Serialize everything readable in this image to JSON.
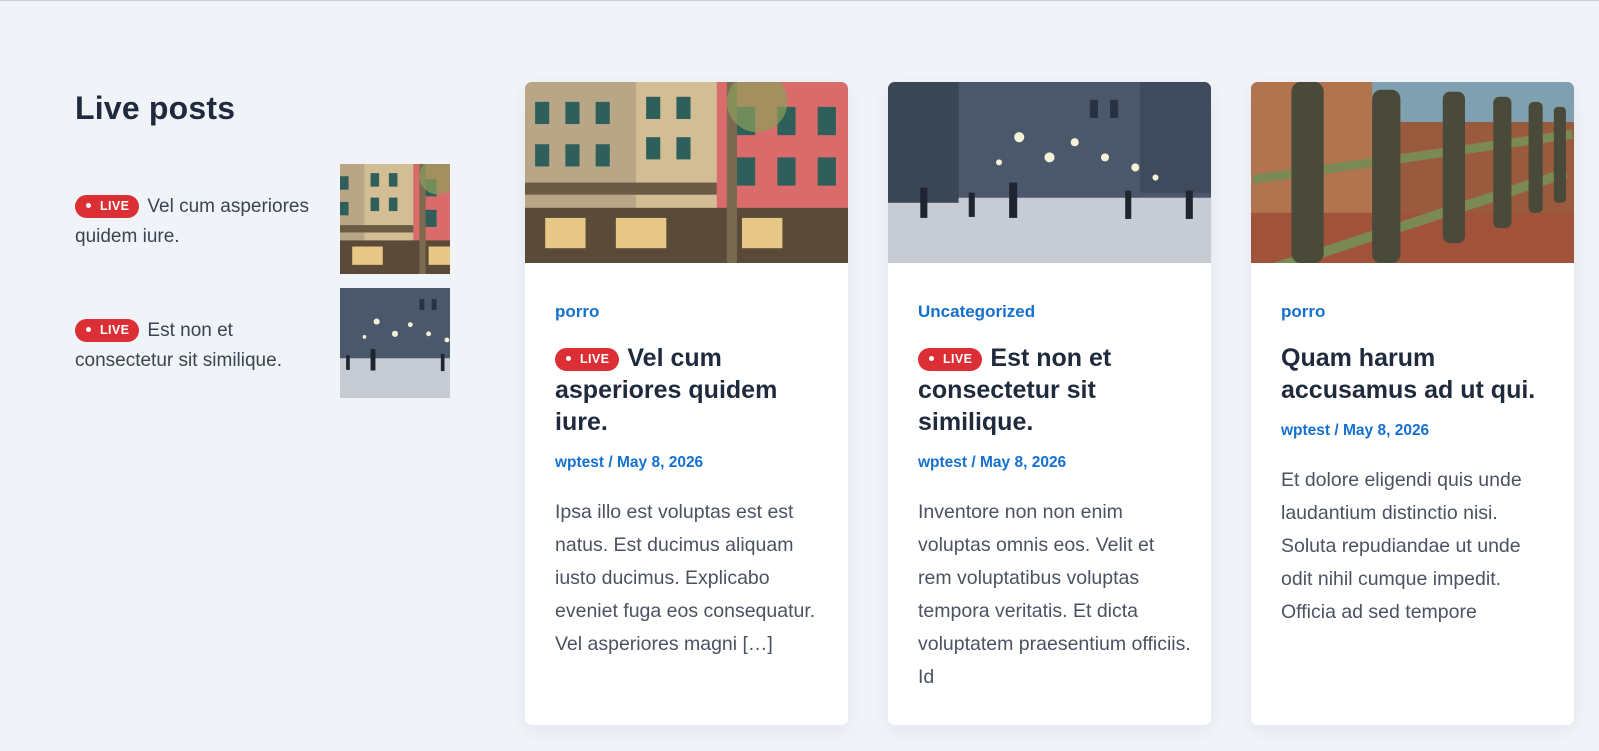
{
  "sidebar": {
    "title": "Live posts",
    "items": [
      {
        "badge": "LIVE",
        "text": "Vel cum asperiores quidem iure.",
        "thumb": "building-photo"
      },
      {
        "badge": "LIVE",
        "text": "Est non et consectetur sit similique.",
        "thumb": "snowy-street-photo"
      }
    ]
  },
  "cards": [
    {
      "image": "building-photo",
      "category": "porro",
      "live": true,
      "badge": "LIVE",
      "title": "Vel cum asperiores quidem iure.",
      "meta": "wptest / May 8, 2026",
      "excerpt": "Ipsa illo est voluptas est est natus. Est ducimus aliquam iusto ducimus. Explicabo eveniet fuga eos consequatur. Vel asperiores magni […]"
    },
    {
      "image": "snowy-street-photo",
      "category": "Uncategorized",
      "live": true,
      "badge": "LIVE",
      "title": "Est non et consectetur sit similique.",
      "meta": "wptest / May 8, 2026",
      "excerpt": "Inventore non non enim voluptas omnis eos. Velit et rem voluptatibus voluptas tempora veritatis. Et dicta voluptatem praesentium officiis. Id"
    },
    {
      "image": "wooden-fence-photo",
      "category": "porro",
      "live": false,
      "title": "Quam harum accusamus ad ut qui.",
      "meta": "wptest / May 8, 2026",
      "excerpt": "Et dolore eligendi quis unde laudantium distinctio nisi. Soluta repudiandae ut unde odit nihil cumque impedit. Officia ad sed tempore"
    }
  ],
  "colors": {
    "accent": "#1570cf",
    "live": "#dc2f35",
    "heading": "#1f2a3d",
    "background": "#f0f4f8"
  }
}
